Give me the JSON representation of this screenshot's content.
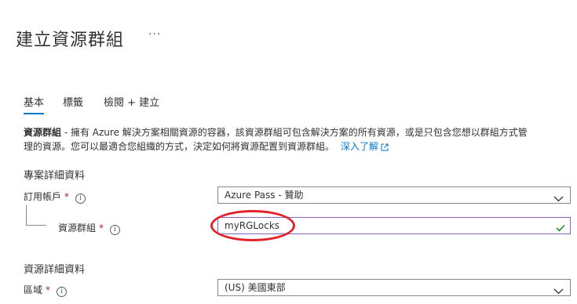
{
  "page": {
    "title": "建立資源群組",
    "more_label": "···"
  },
  "tabs": [
    {
      "label": "基本",
      "active": true
    },
    {
      "label": "標籤",
      "active": false
    },
    {
      "label": "檢閱 + 建立",
      "active": false
    }
  ],
  "description": {
    "term": "資源群組",
    "line1_rest": " - 擁有 Azure 解決方案相關資源的容器，該資源群組可包含解決方案的所有資源，或是只包含您想以群組方式管",
    "line2": "理的資源。您可以最適合您組織的方式，決定如何將資源配置到資源群組。",
    "learn_more": "深入了解"
  },
  "project_details": {
    "heading": "專案詳細資料",
    "subscription": {
      "label": "訂用帳戶",
      "required_mark": "*",
      "value": "Azure Pass - 贊助"
    },
    "resource_group": {
      "label": "資源群組",
      "required_mark": "*",
      "value": "myRGLocks"
    }
  },
  "resource_details": {
    "heading": "資源詳細資料",
    "region": {
      "label": "區域",
      "required_mark": "*",
      "value": "(US) 美國東部"
    }
  },
  "icons": {
    "info": "info-icon",
    "external": "external-link-icon",
    "chevron": "chevron-down-icon",
    "check": "checkmark-icon"
  },
  "colors": {
    "accent": "#0078d4",
    "required": "#a4262c",
    "valid": "#107c10",
    "focus_border": "#8661c5",
    "annotation": "#e3222b"
  }
}
